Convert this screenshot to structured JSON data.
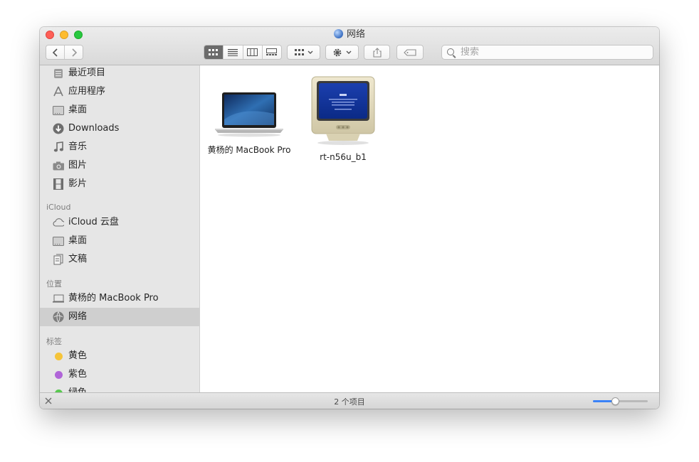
{
  "window": {
    "title": "网络"
  },
  "toolbar": {
    "back_glyph": "‹",
    "forward_glyph": "›",
    "view_modes": [
      "icon-view",
      "list-view",
      "column-view",
      "gallery-view"
    ],
    "active_view": "icon-view",
    "group_by_icon": "grid-icon",
    "action_icon": "gear-icon",
    "share_icon": "share-icon",
    "tag_icon": "tag-icon"
  },
  "search": {
    "placeholder": "搜索"
  },
  "sidebar": {
    "favorites": [
      {
        "label": "最近项目",
        "icon": "recents-icon"
      },
      {
        "label": "应用程序",
        "icon": "applications-icon"
      },
      {
        "label": "桌面",
        "icon": "desktop-icon"
      },
      {
        "label": "Downloads",
        "icon": "downloads-icon"
      },
      {
        "label": "音乐",
        "icon": "music-icon"
      },
      {
        "label": "图片",
        "icon": "camera-icon"
      },
      {
        "label": "影片",
        "icon": "film-icon"
      }
    ],
    "icloud_header": "iCloud",
    "icloud": [
      {
        "label": "iCloud 云盘",
        "icon": "cloud-icon"
      },
      {
        "label": "桌面",
        "icon": "desktop-icon"
      },
      {
        "label": "文稿",
        "icon": "document-icon"
      }
    ],
    "locations_header": "位置",
    "locations": [
      {
        "label": "黄杨的 MacBook Pro",
        "icon": "laptop-icon"
      },
      {
        "label": "网络",
        "icon": "network-icon",
        "selected": true
      }
    ],
    "tags_header": "标签",
    "tags": [
      {
        "label": "黄色",
        "color": "#f5c43a"
      },
      {
        "label": "紫色",
        "color": "#b065d8"
      },
      {
        "label": "绿色",
        "color": "#58c94f"
      }
    ]
  },
  "files": [
    {
      "name": "黄杨的 MacBook Pro",
      "icon": "macbook-icon"
    },
    {
      "name": "rt-n56u_b1",
      "icon": "crt-monitor-icon"
    }
  ],
  "statusbar": {
    "item_count": "2 个项目",
    "icon_size_level": 0.42,
    "left_icon": "close-x-icon"
  },
  "colors": {
    "accent": "#3a82f7",
    "selected_row": "#cfcfcf",
    "sidebar_bg": "#e6e6e6"
  }
}
